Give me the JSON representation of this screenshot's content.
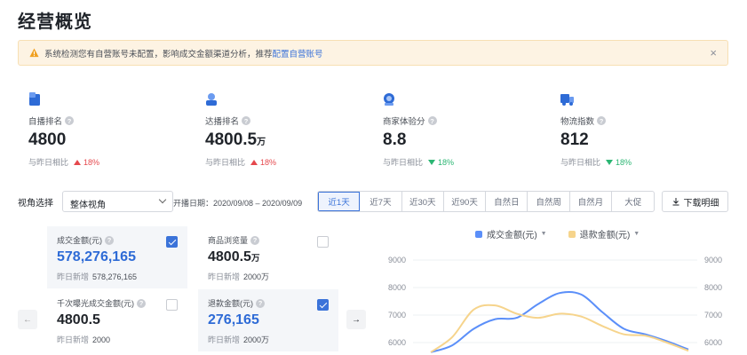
{
  "page": {
    "title": "经营概览"
  },
  "alert": {
    "text": "系统检测您有自营账号未配置，影响成交金额渠道分析，推荐",
    "link": "配置自营账号",
    "close": "×"
  },
  "kpis": [
    {
      "label": "自播排名",
      "value": "4800",
      "unit": "",
      "compare_label": "与昨日相比",
      "trend": "up",
      "pct": "18%",
      "icon": "video-icon"
    },
    {
      "label": "达播排名",
      "value": "4800.5",
      "unit": "万",
      "compare_label": "与昨日相比",
      "trend": "up",
      "pct": "18%",
      "icon": "user-icon"
    },
    {
      "label": "商家体验分",
      "value": "8.8",
      "unit": "",
      "compare_label": "与昨日相比",
      "trend": "down",
      "pct": "18%",
      "icon": "badge-icon"
    },
    {
      "label": "物流指数",
      "value": "812",
      "unit": "",
      "compare_label": "与昨日相比",
      "trend": "down",
      "pct": "18%",
      "icon": "truck-icon"
    }
  ],
  "toolbar": {
    "view_label": "视角选择",
    "view_value": "整体视角",
    "date_range": "开播日期：2020/09/08 – 2020/09/09",
    "tabs": [
      "近1天",
      "近7天",
      "近30天",
      "近90天",
      "自然日",
      "自然周",
      "自然月",
      "大促"
    ],
    "active_tab": "近1天",
    "download": "下载明细"
  },
  "metrics": [
    {
      "label": "成交金额(元)",
      "value": "578,276,165",
      "unit": "",
      "sub_label": "昨日新增",
      "sub_value": "578,276,165",
      "checked": true
    },
    {
      "label": "商品浏览量",
      "value": "4800.5",
      "unit": "万",
      "sub_label": "昨日新增",
      "sub_value": "2000万",
      "checked": false
    },
    {
      "label": "千次曝光成交金额(元)",
      "value": "4800.5",
      "unit": "",
      "sub_label": "昨日新增",
      "sub_value": "2000",
      "checked": false
    },
    {
      "label": "退款金额(元)",
      "value": "276,165",
      "unit": "",
      "sub_label": "昨日新增",
      "sub_value": "2000万",
      "checked": true
    }
  ],
  "colors": {
    "accent": "#3b73d9",
    "series_a": "#5b8ff9",
    "series_b": "#f6d48c",
    "up": "#e5484d",
    "down": "#2bb673"
  },
  "chart_data": {
    "type": "line",
    "legend": [
      {
        "name": "成交金额(元)",
        "color": "#5b8ff9"
      },
      {
        "name": "退款金额(元)",
        "color": "#f6d48c"
      }
    ],
    "y_ticks": [
      9000,
      8000,
      7000,
      6000
    ],
    "ylim": [
      5700,
      9000
    ],
    "x": [
      0,
      1,
      2,
      3,
      4,
      5,
      6,
      7,
      8,
      9,
      10,
      11,
      12
    ],
    "series": [
      {
        "name": "成交金额(元)",
        "values": [
          5650,
          5900,
          6500,
          6850,
          6900,
          7400,
          7800,
          7750,
          7100,
          6500,
          6300,
          6050,
          5750
        ]
      },
      {
        "name": "退款金额(元)",
        "values": [
          5650,
          6200,
          7200,
          7350,
          7050,
          6900,
          7050,
          6950,
          6600,
          6300,
          6250,
          6000,
          5700
        ]
      }
    ]
  }
}
